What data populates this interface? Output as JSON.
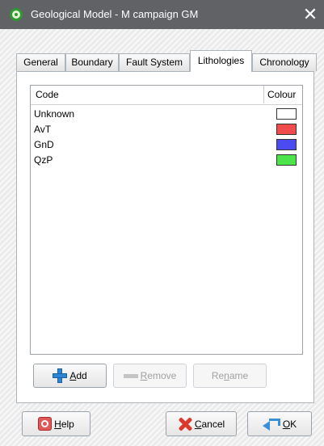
{
  "window": {
    "title": "Geological Model - M campaign GM",
    "close_glyph": "✕"
  },
  "tabs": [
    {
      "label": "General",
      "active": false
    },
    {
      "label": "Boundary",
      "active": false
    },
    {
      "label": "Fault System",
      "active": false
    },
    {
      "label": "Lithologies",
      "active": true
    },
    {
      "label": "Chronology",
      "active": false
    }
  ],
  "lithology_table": {
    "columns": {
      "code": "Code",
      "colour": "Colour"
    },
    "rows": [
      {
        "code": "Unknown",
        "colour": "#ffffff"
      },
      {
        "code": "AvT",
        "colour": "#f24b4b"
      },
      {
        "code": "GnD",
        "colour": "#4b4bf2"
      },
      {
        "code": "QzP",
        "colour": "#4be44b"
      }
    ]
  },
  "actions": {
    "add": {
      "mnemonic": "A",
      "rest": "dd",
      "icon": "plus-icon",
      "enabled": true
    },
    "remove": {
      "mnemonic": "R",
      "rest": "emove",
      "icon": "minus-icon",
      "enabled": false
    },
    "rename": {
      "pre": "Re",
      "mnemonic": "n",
      "rest": "ame",
      "enabled": false
    }
  },
  "footer": {
    "help": {
      "mnemonic": "H",
      "rest": "elp",
      "icon": "help-icon"
    },
    "cancel": {
      "mnemonic": "C",
      "rest": "ancel",
      "icon": "cancel-icon"
    },
    "ok": {
      "mnemonic": "O",
      "rest": "K",
      "icon": "ok-icon"
    }
  }
}
